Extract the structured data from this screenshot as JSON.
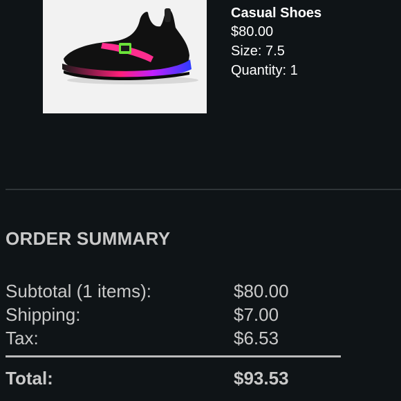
{
  "product": {
    "name": "Casual Shoes",
    "price": "$80.00",
    "size": "Size: 7.5",
    "quantity": "Quantity: 1",
    "image_icon": "sneaker-image"
  },
  "summary": {
    "title": "ORDER SUMMARY",
    "subtotal_label": "Subtotal (1 items):",
    "subtotal_value": "$80.00",
    "shipping_label": "Shipping:",
    "shipping_value": "$7.00",
    "tax_label": "Tax:",
    "tax_value": "$6.53",
    "total_label": "Total:",
    "total_value": "$93.53"
  },
  "colors": {
    "background": "#0f1417",
    "text_muted": "#c9c9c9",
    "shoe_pink": "#ff2d8f",
    "shoe_blue": "#3a3cff",
    "shoe_green": "#6be33a"
  }
}
